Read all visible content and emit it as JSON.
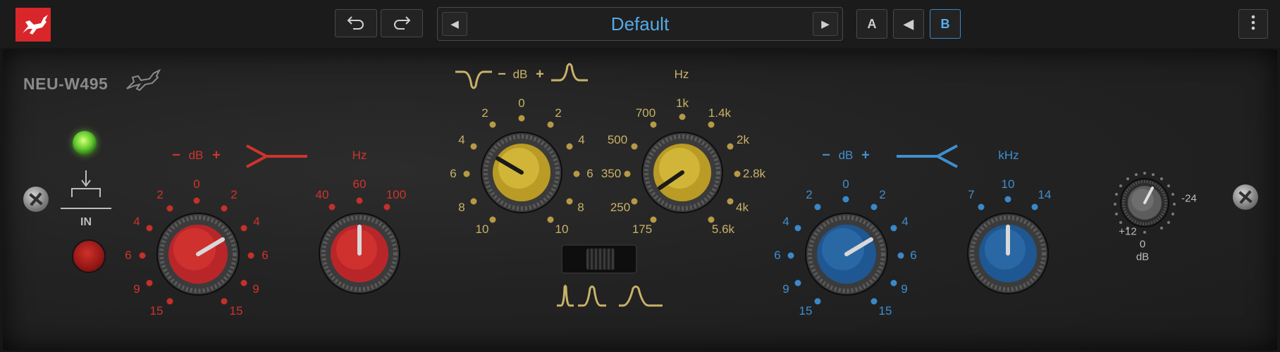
{
  "toolbar": {
    "preset_name": "Default",
    "undo_icon": "undo-icon",
    "redo_icon": "redo-icon",
    "prev_icon": "chevron-left-icon",
    "next_icon": "chevron-right-icon",
    "a_label": "A",
    "copy_icon": "arrow-left-icon",
    "b_label": "B",
    "menu_icon": "kebab-menu-icon",
    "active_slot": "B",
    "accent": "#56a9e6"
  },
  "plugin": {
    "name": "NEU-W495",
    "in_label": "IN",
    "colors": {
      "red": "#d0342d",
      "yellow": "#c9b268",
      "blue": "#3f8fd0"
    }
  },
  "low_gain": {
    "header_minus": "−",
    "header_db": "dB",
    "header_plus": "+",
    "ticks": [
      "0",
      "2",
      "2",
      "4",
      "4",
      "6",
      "6",
      "9",
      "9",
      "15",
      "15"
    ]
  },
  "low_freq": {
    "header": "Hz",
    "ticks": [
      "40",
      "60",
      "100"
    ]
  },
  "mid_gain": {
    "header_minus": "−",
    "header_db": "dB",
    "header_plus": "+",
    "ticks": [
      "0",
      "2",
      "2",
      "4",
      "4",
      "6",
      "6",
      "8",
      "8",
      "10",
      "10"
    ]
  },
  "mid_freq": {
    "header": "Hz",
    "ticks": [
      "1k",
      "700",
      "1.4k",
      "500",
      "2k",
      "350",
      "2.8k",
      "250",
      "4k",
      "175",
      "5.6k"
    ]
  },
  "high_gain": {
    "header_minus": "−",
    "header_db": "dB",
    "header_plus": "+",
    "ticks": [
      "0",
      "2",
      "2",
      "4",
      "4",
      "6",
      "6",
      "9",
      "9",
      "15",
      "15"
    ]
  },
  "high_freq": {
    "header": "kHz",
    "ticks": [
      "7",
      "10",
      "14"
    ]
  },
  "output": {
    "min_label": "+12",
    "max_label": "-24",
    "center_value": "0",
    "unit": "dB"
  }
}
